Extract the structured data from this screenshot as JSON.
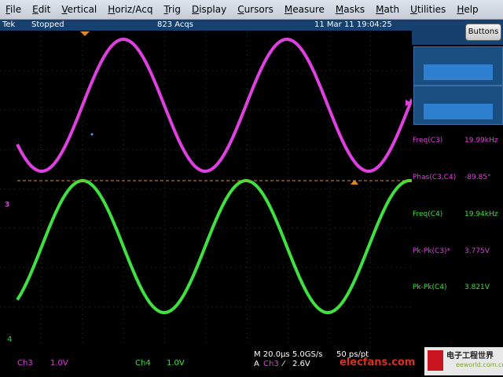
{
  "menu": {
    "items": [
      "File",
      "Edit",
      "Vertical",
      "Horiz/Acq",
      "Trig",
      "Display",
      "Cursors",
      "Measure",
      "Masks",
      "Math",
      "Utilities",
      "Help"
    ]
  },
  "status": {
    "brand": "Tek",
    "run_state": "Stopped",
    "acquisitions": "823 Acqs",
    "timestamp": "11 Mar 11 19:04:25"
  },
  "panel": {
    "buttons_label": "Buttons"
  },
  "measurements": [
    {
      "label": "Freq(C3)",
      "value": "19.99kHz",
      "color": "#e040e0"
    },
    {
      "label": "Phas(C3,C4)",
      "value": "-89.85°",
      "color": "#e040e0"
    },
    {
      "label": "Freq(C4)",
      "value": "19.94kHz",
      "color": "#40e040"
    },
    {
      "label": "Pk-Pk(C3)*",
      "value": "3.775V",
      "color": "#e040e0"
    },
    {
      "label": "Pk-Pk(C4)",
      "value": "3.821V",
      "color": "#40e040"
    }
  ],
  "channels": {
    "ch3_label": "Ch3",
    "ch3_scale": "1.0V",
    "ch4_label": "Ch4",
    "ch4_scale": "1.0V",
    "ch3_color": "#e040e0",
    "ch4_color": "#40e040"
  },
  "timebase": {
    "horizontal": "M 20.0µs 5.0GS/s",
    "resolution": "50 ps/pt",
    "trigger_mode": "A",
    "trigger_source": "Ch3",
    "trigger_slope": "⁄",
    "trigger_level": "2.6V"
  },
  "markers": {
    "ch3_ground": "3",
    "ch4_ground": "4"
  },
  "watermark": {
    "text1": "电子工程世界",
    "text2": "eeworld.com.cn",
    "overlay": "elecfans.com"
  }
}
